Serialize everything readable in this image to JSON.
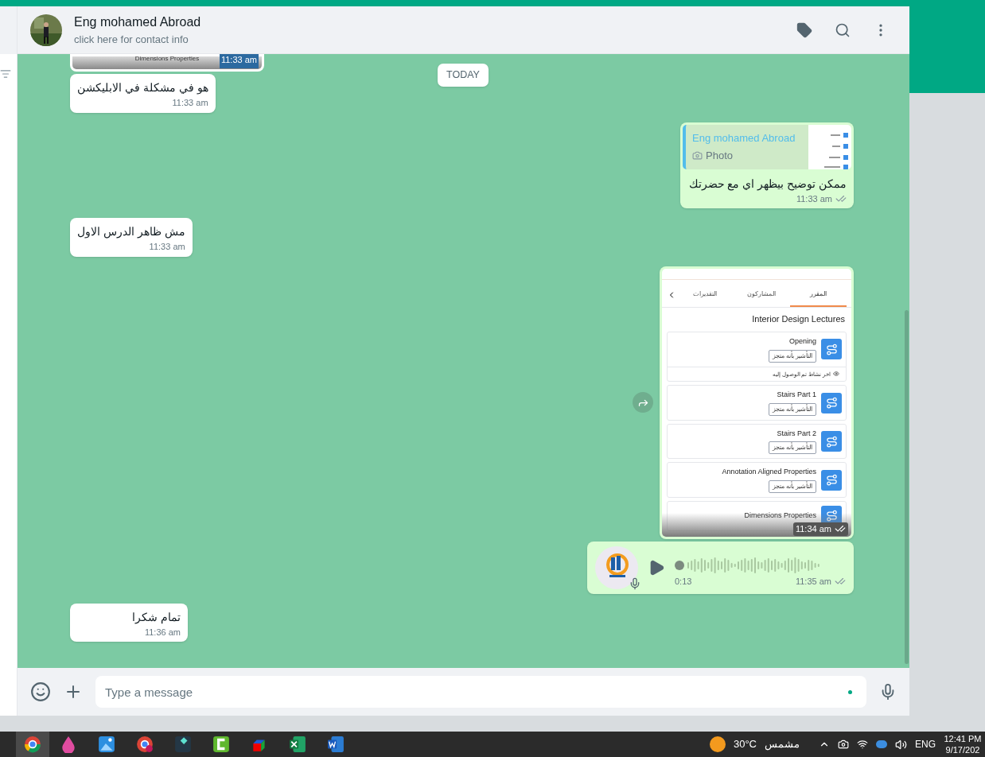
{
  "header": {
    "name": "Eng mohamed Abroad",
    "subtitle": "click here for contact info"
  },
  "date_chip": "TODAY",
  "messages": [
    {
      "kind": "image_partial",
      "outgoing": false,
      "caption": "Dimensions Properties",
      "time": "11:33 am"
    },
    {
      "kind": "text",
      "outgoing": false,
      "text": "هو في مشكلة في الابليكشن",
      "time": "11:33 am"
    },
    {
      "kind": "reply",
      "outgoing": true,
      "quote": {
        "author": "Eng mohamed Abroad",
        "label": "Photo"
      },
      "text": "ممكن توضيح بيظهر اي مع حضرتك",
      "time": "11:33 am",
      "delivered": true
    },
    {
      "kind": "text",
      "outgoing": false,
      "text": "مش ظاهر الدرس الاول",
      "time": "11:33 am"
    },
    {
      "kind": "screenshot",
      "outgoing": true,
      "time": "11:34 am",
      "delivered": true,
      "screen": {
        "tabs": [
          {
            "label": "المقرر",
            "selected": true
          },
          {
            "label": "المشاركون",
            "selected": false
          },
          {
            "label": "التقديرات",
            "selected": false
          }
        ],
        "title": "Interior Design Lectures",
        "lessons": [
          {
            "title": "Opening",
            "tag": "التأشير بأنه متجز",
            "note": "اخر نشاط تم الوصول إليه"
          },
          {
            "title": "Stairs Part 1",
            "tag": "التأشير بأنه متجز"
          },
          {
            "title": "Stairs Part 2",
            "tag": "التأشير بأنه متجز"
          },
          {
            "title": "Annotation Aligned Properties",
            "tag": "التأشير بأنه متجز"
          },
          {
            "title": "Dimensions Properties"
          }
        ]
      }
    },
    {
      "kind": "voice",
      "outgoing": true,
      "duration": "0:13",
      "time": "11:35 am",
      "delivered": true
    },
    {
      "kind": "text",
      "outgoing": false,
      "text": "تمام شكرا",
      "time": "11:36 am"
    }
  ],
  "composer": {
    "placeholder": "Type a message"
  },
  "taskbar": {
    "apps": [
      {
        "selected": true
      },
      {
        "selected": false
      },
      {
        "selected": false
      },
      {
        "selected": false
      },
      {
        "selected": false
      },
      {
        "selected": false
      },
      {
        "selected": false
      },
      {
        "selected": false
      },
      {
        "selected": false
      }
    ],
    "temperature": "30°C",
    "weather": "مشمس",
    "language": "ENG",
    "time": "12:41 PM",
    "date": "9/17/202"
  }
}
